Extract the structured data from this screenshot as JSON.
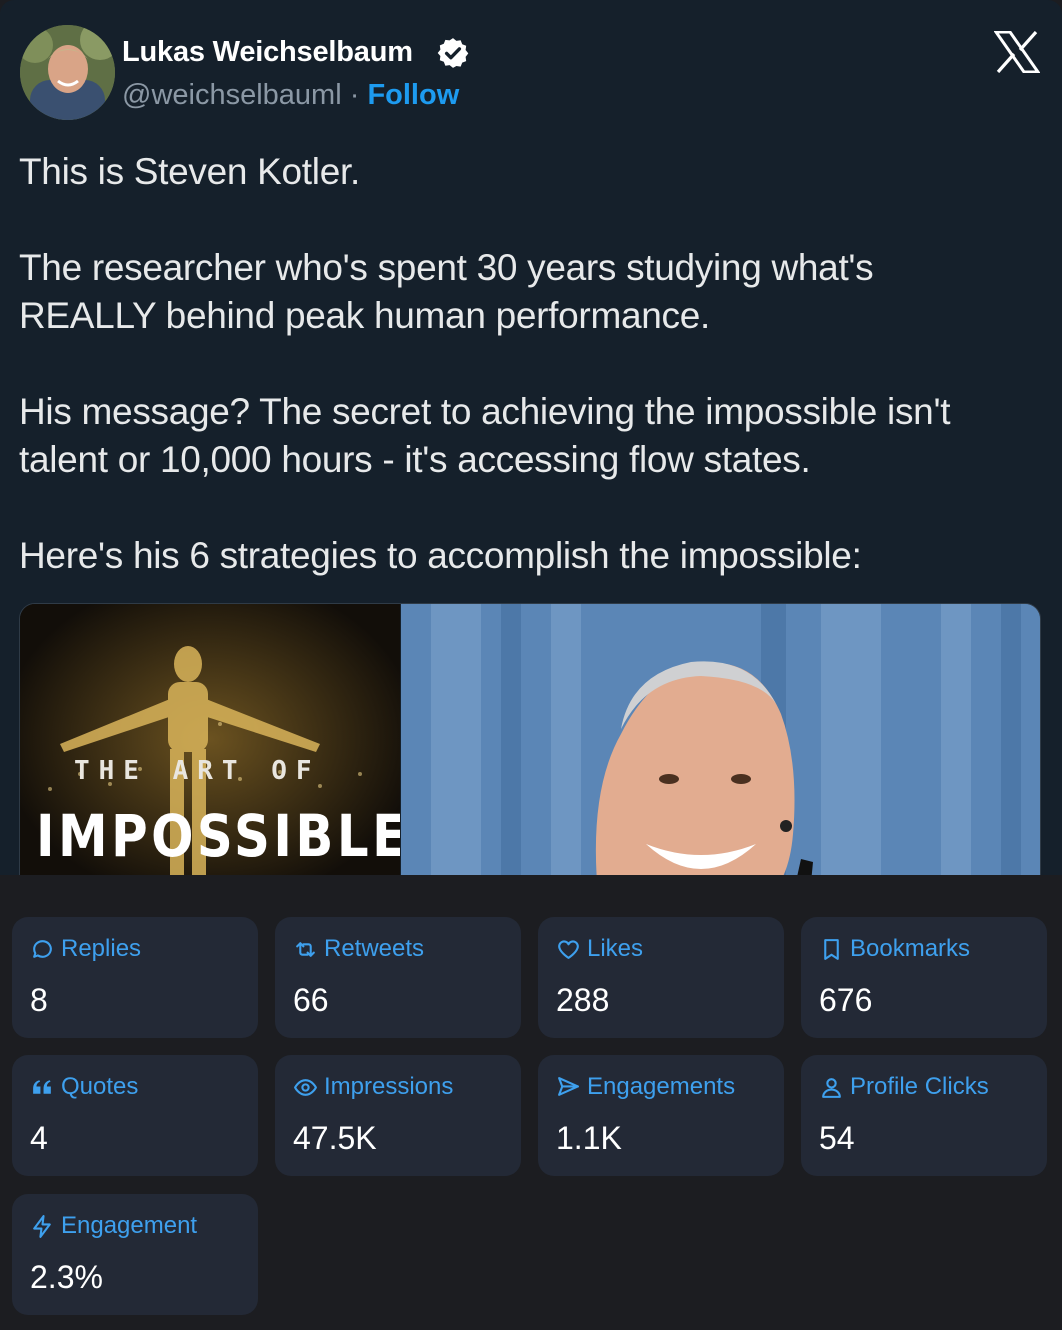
{
  "author": {
    "name": "Lukas Weichselbaum",
    "handle": "@weichselbauml",
    "separator": "·",
    "follow_label": "Follow"
  },
  "tweet": {
    "text": "This is Steven Kotler.\n\nThe researcher who's spent 30 years studying what's\nREALLY behind peak human performance.\n\nHis message? The secret to achieving the impossible isn't\ntalent or 10,000 hours - it's accessing flow states.\n\nHere's his 6 strategies to accomplish the impossible:",
    "media": {
      "book_title_small": "THE ART OF",
      "book_title_big": "IMPOSSIBLE"
    }
  },
  "stats": [
    {
      "key": "replies",
      "label": "Replies",
      "value": "8",
      "icon": "speech-bubble-icon"
    },
    {
      "key": "retweets",
      "label": "Retweets",
      "value": "66",
      "icon": "retweet-icon"
    },
    {
      "key": "likes",
      "label": "Likes",
      "value": "288",
      "icon": "heart-icon"
    },
    {
      "key": "bookmarks",
      "label": "Bookmarks",
      "value": "676",
      "icon": "bookmark-icon"
    },
    {
      "key": "quotes",
      "label": "Quotes",
      "value": "4",
      "icon": "quote-icon"
    },
    {
      "key": "impressions",
      "label": "Impressions",
      "value": "47.5K",
      "icon": "eye-icon"
    },
    {
      "key": "engagements",
      "label": "Engagements",
      "value": "1.1K",
      "icon": "send-icon"
    },
    {
      "key": "profile_clicks",
      "label": "Profile Clicks",
      "value": "54",
      "icon": "person-icon"
    },
    {
      "key": "engagement",
      "label": "Engagement",
      "value": "2.3%",
      "icon": "lightning-icon"
    }
  ],
  "colors": {
    "accent": "#1d9bf0",
    "stat_label": "#3ea0ee",
    "card_bg": "#232936",
    "tweet_bg": "#15202b"
  }
}
